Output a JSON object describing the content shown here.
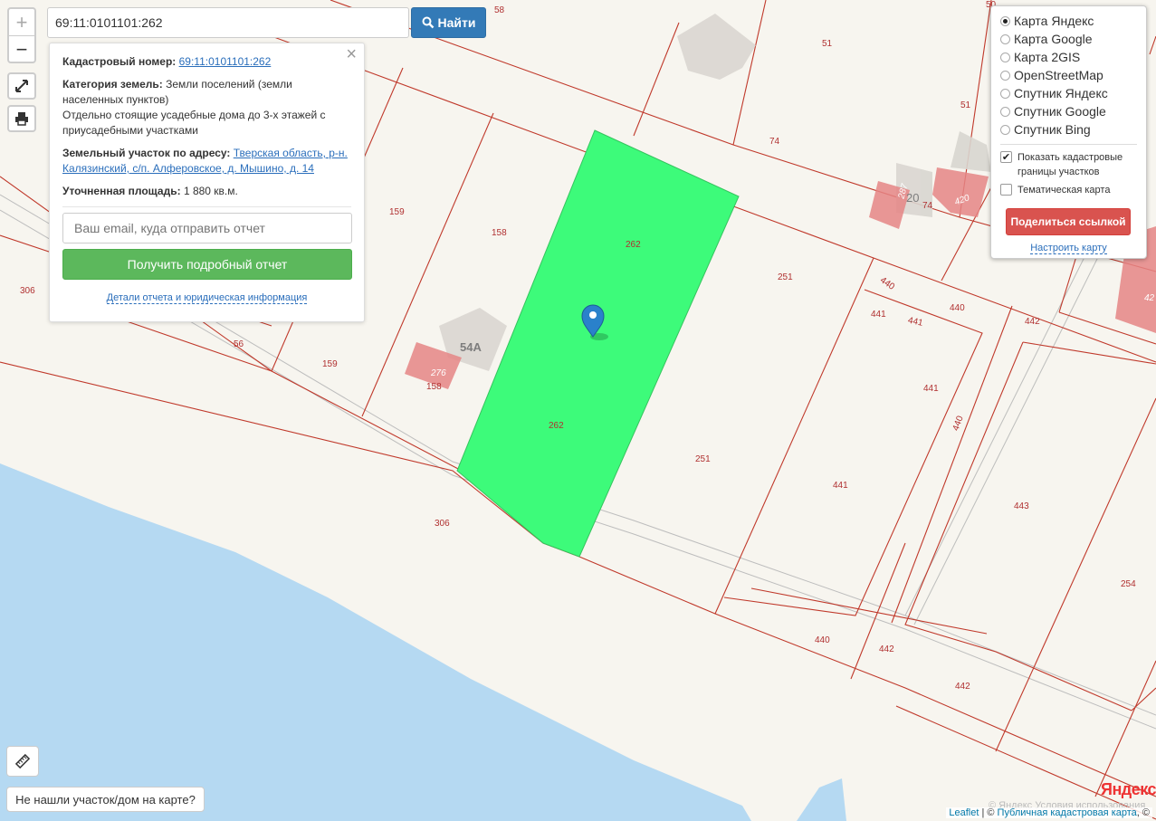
{
  "search": {
    "value": "69:11:0101101:262",
    "button_label": "Найти"
  },
  "controls": {
    "zoom_in": "+",
    "zoom_out": "−"
  },
  "info": {
    "cadastral_label": "Кадастровый номер:",
    "cadastral_value": "69:11:0101101:262",
    "category_label": "Категория земель:",
    "category_value": "Земли поселений (земли населенных пунктов)",
    "use_text": "Отдельно стоящие усадебные дома до 3-х этажей с приусадебными участками",
    "address_label": "Земельный участок по адресу:",
    "address_value": "Тверская область, р-н. Калязинский, с/п. Алферовское, д. Мышино, д. 14",
    "area_label": "Уточненная площадь:",
    "area_value": "1 880 кв.м.",
    "email_placeholder": "Ваш email, куда отправить отчет",
    "report_button": "Получить подробный отчет",
    "details_link": "Детали отчета и юридическая информация"
  },
  "layers": {
    "options": [
      "Карта Яндекс",
      "Карта Google",
      "Карта 2GIS",
      "OpenStreetMap",
      "Спутник Яндекс",
      "Спутник Google",
      "Спутник Bing"
    ],
    "selected": "Карта Яндекс",
    "show_borders_label": "Показать кадастровые границы участков",
    "show_borders_checked": true,
    "thematic_label": "Тематическая карта",
    "thematic_checked": false,
    "share_button": "Поделиться ссылкой",
    "configure_link": "Настроить карту"
  },
  "map": {
    "plot_labels": [
      "262",
      "262",
      "158",
      "159",
      "159",
      "158",
      "56",
      "306",
      "306",
      "58",
      "51",
      "51",
      "74",
      "74",
      "251",
      "251",
      "440",
      "441",
      "441",
      "441",
      "441",
      "440",
      "442",
      "440",
      "441",
      "443",
      "254",
      "440",
      "442",
      "442",
      "50"
    ],
    "building_labels": [
      "54А",
      "276",
      "287",
      "20",
      "420",
      "42"
    ],
    "colors": {
      "selected_plot": "#3dfb7a",
      "boundary": "#c0392b",
      "water": "#b5d9f2",
      "land": "#f7f5ef"
    }
  },
  "bottom": {
    "not_found": "Не нашли участок/дом на карте?",
    "yandex_logo": "Яндекс",
    "yandex_terms": "© Яндекс  Условия использования",
    "attribution_leaflet": "Leaflet",
    "attribution_sep": " | © ",
    "attribution_pkk": "Публичная кадастровая карта",
    "attribution_tail": ", ©"
  }
}
